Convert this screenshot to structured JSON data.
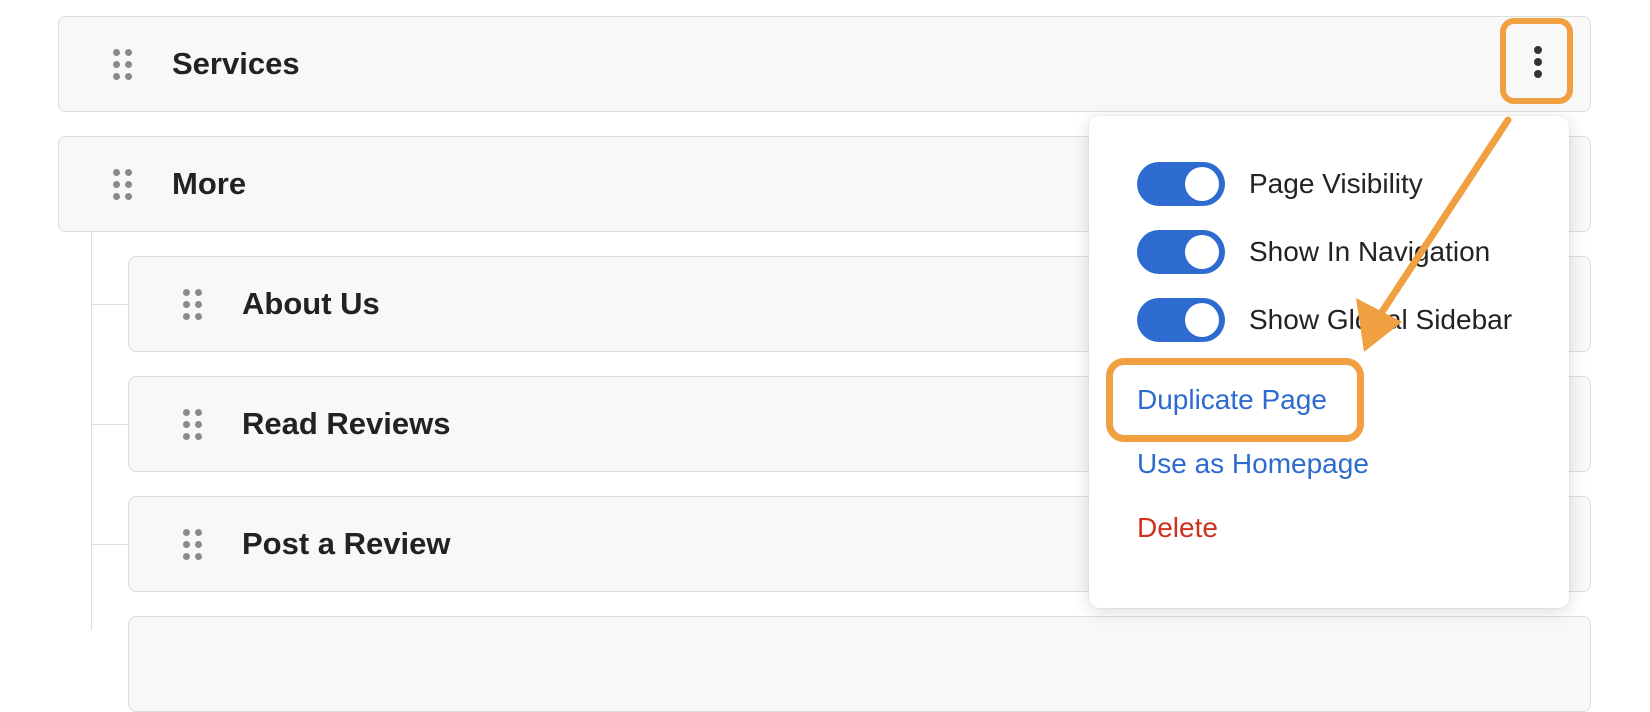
{
  "rows": {
    "services": {
      "label": "Services"
    },
    "more": {
      "label": "More"
    },
    "about": {
      "label": "About Us"
    },
    "reviews": {
      "label": "Read Reviews"
    },
    "post_review": {
      "label": "Post a Review"
    }
  },
  "menu": {
    "toggles": [
      {
        "label": "Page Visibility",
        "on": true
      },
      {
        "label": "Show In Navigation",
        "on": true
      },
      {
        "label": "Show Global Sidebar",
        "on": true
      }
    ],
    "duplicate_label": "Duplicate Page",
    "homepage_label": "Use as Homepage",
    "delete_label": "Delete"
  },
  "icons": {
    "drag": "drag-handle-icon",
    "more": "vertical-dots-icon"
  },
  "colors": {
    "accent": "#2e6bd0",
    "danger": "#d0311f",
    "highlight": "#f0a040"
  }
}
